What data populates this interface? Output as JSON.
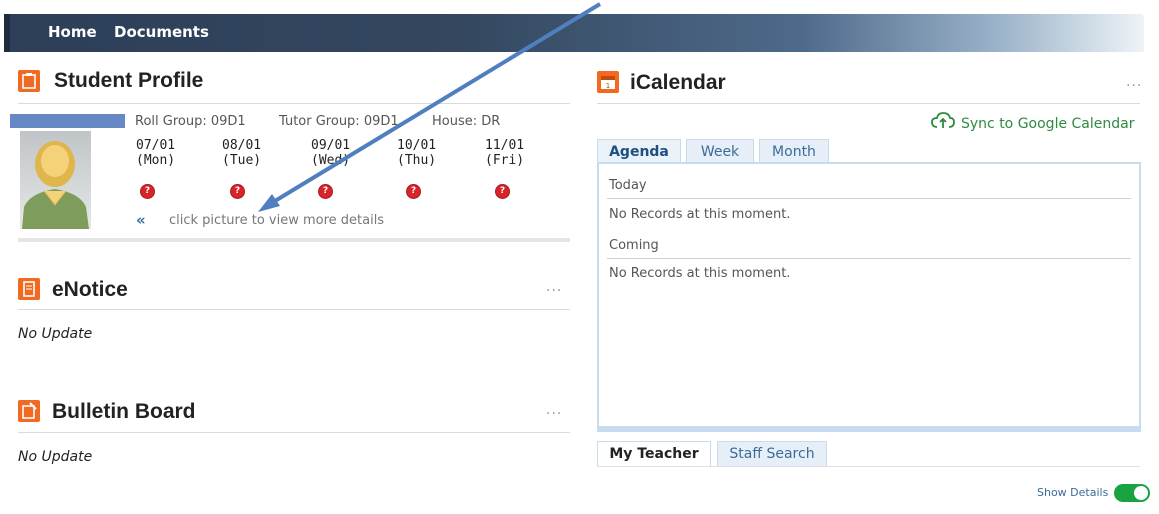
{
  "nav": {
    "home": "Home",
    "documents": "Documents"
  },
  "student_profile": {
    "title": "Student Profile",
    "roll_group": "Roll Group: 09D1",
    "tutor_group": "Tutor Group: 09D1",
    "house": "House: DR",
    "days": [
      {
        "date": "07/01",
        "day": "(Mon)"
      },
      {
        "date": "08/01",
        "day": "(Tue)"
      },
      {
        "date": "09/01",
        "day": "(Wed)"
      },
      {
        "date": "10/01",
        "day": "(Thu)"
      },
      {
        "date": "11/01",
        "day": "(Fri)"
      }
    ],
    "status_glyph": "?",
    "hint_chevron": "«",
    "hint": "click picture to view more details"
  },
  "enotice": {
    "title": "eNotice",
    "content": "No Update",
    "more": "..."
  },
  "bulletin": {
    "title": "Bulletin Board",
    "content": "No Update",
    "more": "..."
  },
  "calendar": {
    "title": "iCalendar",
    "more": "...",
    "sync": "Sync to Google Calendar",
    "tabs": [
      "Agenda",
      "Week",
      "Month"
    ],
    "today_label": "Today",
    "today_text": "No Records at this moment.",
    "coming_label": "Coming",
    "coming_text": "No Records at this moment."
  },
  "teacher_tabs": [
    "My Teacher",
    "Staff Search"
  ],
  "show_details": {
    "label": "Show Details",
    "on": true
  },
  "colors": {
    "accent_orange": "#f26a22",
    "nav_dark": "#2d3f58",
    "link_blue": "#3c6b99",
    "toggle_green": "#19a340",
    "sync_green": "#2e8b3e"
  },
  "icons": [
    "student-profile-icon",
    "enotice-icon",
    "bulletin-board-icon",
    "icalendar-icon",
    "cloud-upload-icon",
    "question-status-icon",
    "chevron-left-icon",
    "avatar"
  ]
}
